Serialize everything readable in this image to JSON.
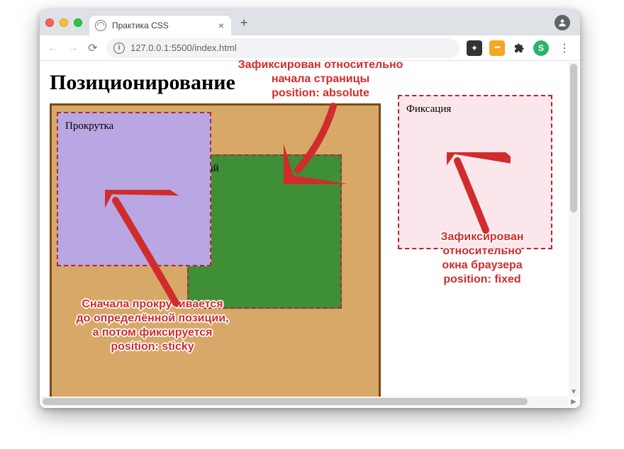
{
  "browser": {
    "tab_title": "Практика CSS",
    "new_tab_tooltip": "+",
    "address": "127.0.0.1:5500/index.html",
    "profile_initial": "S"
  },
  "page": {
    "heading": "Позиционирование",
    "boxes": {
      "sticky_label": "Прокрутка",
      "absolute_label": "Абсолютный",
      "absolute_label_truncated": "тный",
      "fixed_label": "Фиксация"
    }
  },
  "annotations": {
    "absolute": "Зафиксирован относительно\nначала страницы\nposition: absolute",
    "sticky": "Сначала прокручивается\nдо определённой позиции,\nа потом фиксируется\nposition: sticky",
    "fixed": "Зафиксирован\nотносительно\nокна браузера\nposition: fixed"
  }
}
